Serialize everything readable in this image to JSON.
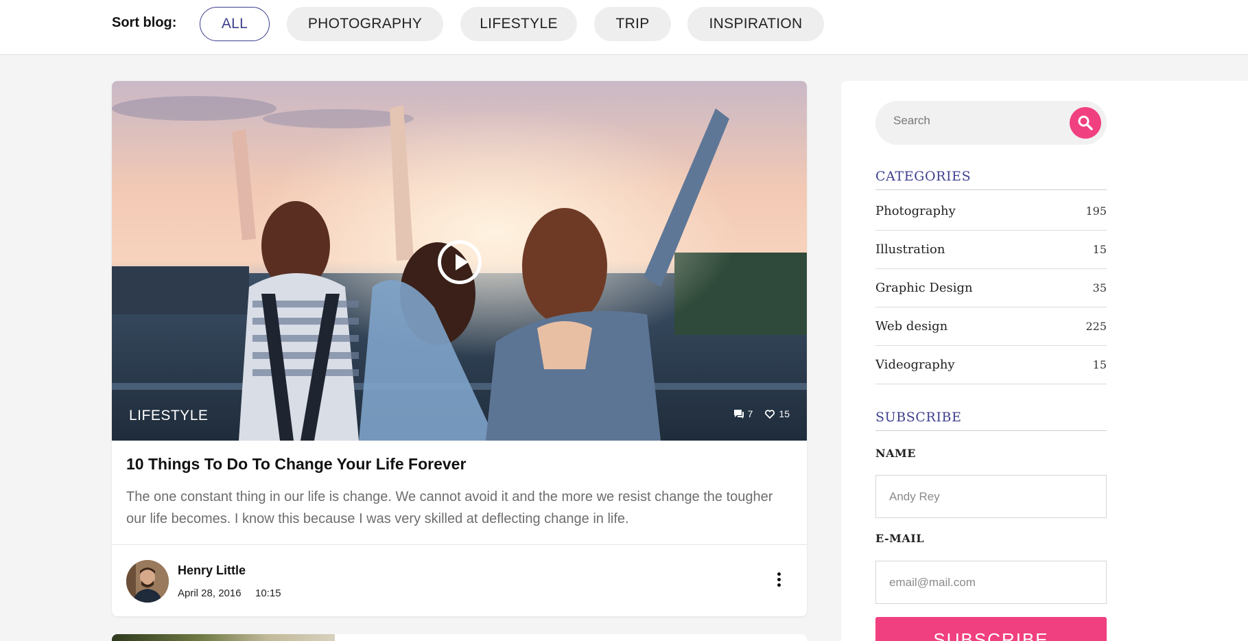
{
  "filter_bar": {
    "label": "Sort blog:",
    "chips": [
      {
        "label": "ALL",
        "active": true
      },
      {
        "label": "PHOTOGRAPHY",
        "active": false
      },
      {
        "label": "LIFESTYLE",
        "active": false
      },
      {
        "label": "TRIP",
        "active": false
      },
      {
        "label": "INSPIRATION",
        "active": false
      }
    ]
  },
  "post": {
    "category": "LIFESTYLE",
    "comments": "7",
    "likes": "15",
    "title": "10 Things To Do To Change Your Life Forever",
    "excerpt": "The one constant thing in our life is change. We cannot avoid it and the more we resist change the tougher our life becomes. I know this because I was very skilled at deflecting change in life.",
    "author": "Henry Little",
    "date": "April 28, 2016",
    "time": "10:15"
  },
  "sidebar": {
    "search": {
      "placeholder": "Search"
    },
    "categories": {
      "heading": "CATEGORIES",
      "items": [
        {
          "label": "Photography",
          "count": "195"
        },
        {
          "label": "Illustration",
          "count": "15"
        },
        {
          "label": "Graphic Design",
          "count": "35"
        },
        {
          "label": "Web design",
          "count": "225"
        },
        {
          "label": "Videography",
          "count": "15"
        }
      ]
    },
    "subscribe": {
      "heading": "SUBSCRIBE",
      "name_label": "NAME",
      "name_placeholder": "Andy Rey",
      "email_label": "E-MAIL",
      "email_placeholder": "email@mail.com",
      "button_label": "SUBSCRIBE"
    }
  },
  "colors": {
    "accent_pink": "#f0407f",
    "accent_indigo": "#3d3f8e",
    "page_bg": "#f4f4f4"
  },
  "icons": [
    "play-icon",
    "comment-icon",
    "heart-icon",
    "search-icon",
    "more-vertical-icon"
  ]
}
